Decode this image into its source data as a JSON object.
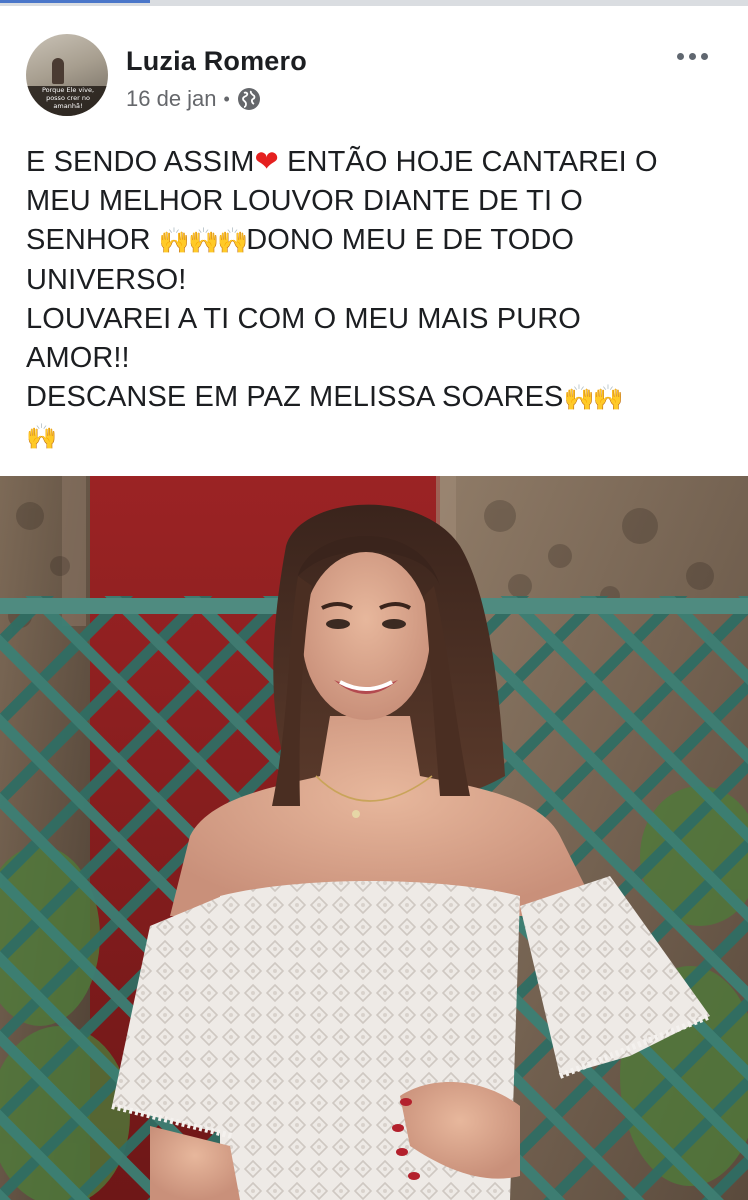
{
  "author": {
    "name": "Luzia Romero",
    "avatar_caption": "Porque Ele vive, posso crer no amanhã!"
  },
  "post_meta": {
    "date": "16 de jan",
    "separator": "•",
    "audience_icon": "globe-icon"
  },
  "more_options_icon": "more-horizontal-icon",
  "post_text": {
    "line1": "E SENDO ASSIM",
    "line1_emoji": "❤",
    "line1_rest": " ENTÃO HOJE CANTAREI O",
    "line2": "MEU MELHOR LOUVOR DIANTE DE TI O",
    "line3": "SENHOR ",
    "line3_emoji": "🙌🙌🙌",
    "line3_rest": "DONO MEU E DE TODO",
    "line4": "UNIVERSO!",
    "line5": "LOUVAREI A TI COM O MEU MAIS PURO",
    "line6": "AMOR!!",
    "line7": "DESCANSE EM PAZ  MELISSA  SOARES",
    "line7_emoji": "🙌🙌",
    "line8_emoji": "🙌"
  },
  "photo": {
    "subject": "photo-of-young-woman-in-white-off-shoulder-dress"
  },
  "colors": {
    "text_primary": "#1c1e21",
    "text_secondary": "#65676b",
    "heart": "#e5201f",
    "raising_hands": "#f3b91a",
    "lattice": "#2d6a5e"
  }
}
